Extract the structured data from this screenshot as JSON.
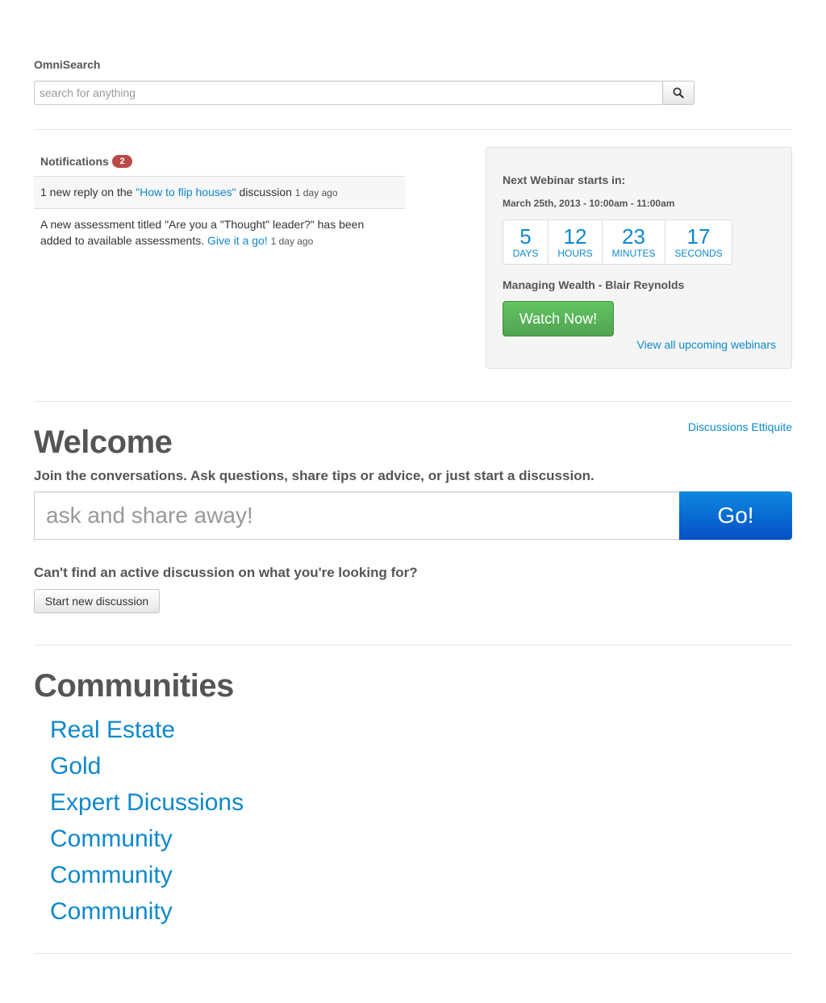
{
  "omnisearch": {
    "label": "OmniSearch",
    "placeholder": "search for anything",
    "button_icon": "search-icon"
  },
  "notifications": {
    "title": "Notifications",
    "count": "2",
    "items": [
      {
        "pre": "1 new reply on the ",
        "link": "\"How to flip houses\"",
        "post": " discussion",
        "time": "1 day ago"
      },
      {
        "pre": "A new assessment titled \"Are you a \"Thought\" leader?\" has been added to available assessments. ",
        "link": "Give it a go!",
        "post": "",
        "time": "1 day ago"
      }
    ]
  },
  "webinar": {
    "title": "Next Webinar starts in:",
    "date": "March 25th, 2013 - 10:00am - 11:00am",
    "countdown": [
      {
        "value": "5",
        "label": "DAYS"
      },
      {
        "value": "12",
        "label": "HOURS"
      },
      {
        "value": "23",
        "label": "MINUTES"
      },
      {
        "value": "17",
        "label": "SECONDS"
      }
    ],
    "name": "Managing Wealth - Blair Reynolds",
    "watch_label": "Watch Now!",
    "view_all_label": "View all upcoming webinars"
  },
  "welcome": {
    "etiquette_link": "Discussions Ettiquite",
    "title": "Welcome",
    "subtitle": "Join the conversations. Ask questions, share tips or advice, or just start a discussion.",
    "ask_placeholder": "ask and share away!",
    "go_label": "Go!",
    "cant_find": "Can't find an active discussion on what you're looking for?",
    "start_label": "Start new discussion"
  },
  "communities": {
    "title": "Communities",
    "items": [
      "Real Estate",
      "Gold",
      "Expert Dicussions",
      "Community",
      "Community",
      "Community"
    ]
  },
  "colors": {
    "link": "#0e88cc",
    "badge": "#b94a48",
    "watch_button": "#51a351",
    "go_button": "#0550c5"
  }
}
